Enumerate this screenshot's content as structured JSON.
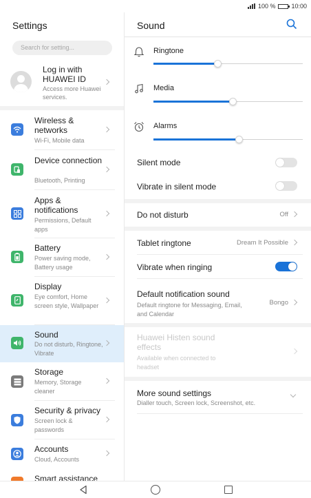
{
  "status": {
    "battery_percent": "100 %",
    "time": "10:00"
  },
  "left": {
    "title": "Settings",
    "search_placeholder": "Search for setting...",
    "account": {
      "title": "Log in with HUAWEI ID",
      "subtitle": "Access more Huawei services."
    },
    "items": [
      {
        "label": "Wireless & networks",
        "sub": "Wi-Fi, Mobile data",
        "icon": "wifi-icon",
        "color": "#3b7ddd"
      },
      {
        "label": "Device connection",
        "sub": "Bluetooth, Printing",
        "icon": "device-connection-icon",
        "color": "#3fb56b"
      },
      {
        "label": "Apps & notifications",
        "sub": "Permissions, Default apps",
        "icon": "apps-icon",
        "color": "#3b7ddd"
      },
      {
        "label": "Battery",
        "sub": "Power saving mode, Battery usage",
        "icon": "battery-icon",
        "color": "#3fb56b"
      },
      {
        "label": "Display",
        "sub": "Eye comfort, Home screen style, Wallpaper",
        "icon": "display-icon",
        "color": "#3fb56b"
      },
      {
        "label": "Sound",
        "sub": "Do not disturb, Ringtone, Vibrate",
        "icon": "sound-icon",
        "color": "#3fb56b"
      },
      {
        "label": "Storage",
        "sub": "Memory, Storage cleaner",
        "icon": "storage-icon",
        "color": "#7a7a7a"
      },
      {
        "label": "Security & privacy",
        "sub": "Screen lock & passwords",
        "icon": "security-icon",
        "color": "#3b7ddd"
      },
      {
        "label": "Accounts",
        "sub": "Cloud, Accounts",
        "icon": "accounts-icon",
        "color": "#3b7ddd"
      },
      {
        "label": "Smart assistance",
        "sub": "",
        "icon": "smart-assistance-icon",
        "color": "#f07a2b"
      }
    ]
  },
  "right": {
    "title": "Sound",
    "volumes": [
      {
        "label": "Ringtone",
        "level": 0.43
      },
      {
        "label": "Media",
        "level": 0.53
      },
      {
        "label": "Alarms",
        "level": 0.57
      }
    ],
    "silent_mode": {
      "label": "Silent mode",
      "on": false
    },
    "vibrate_silent": {
      "label": "Vibrate in silent mode",
      "on": false
    },
    "dnd": {
      "label": "Do not disturb",
      "value": "Off"
    },
    "tablet_ringtone": {
      "label": "Tablet ringtone",
      "value": "Dream It Possible"
    },
    "vibrate_ringing": {
      "label": "Vibrate when ringing",
      "on": true
    },
    "default_notification": {
      "label": "Default notification sound",
      "sub": "Default ringtone for Messaging, Email, and Calendar",
      "value": "Bongo"
    },
    "histen": {
      "label": "Huawei Histen sound effects",
      "sub": "Available when connected to headset"
    },
    "more": {
      "label": "More sound settings",
      "sub": "Dialler touch, Screen lock, Screenshot, etc."
    }
  },
  "colors": {
    "accent": "#1a73d8",
    "selected_bg": "#dfeefb"
  }
}
